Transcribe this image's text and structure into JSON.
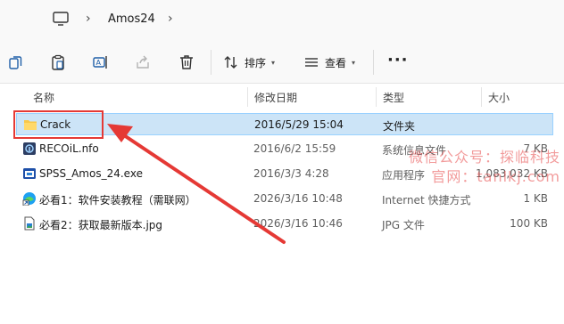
{
  "address": {
    "path": "Amos24"
  },
  "toolbar": {
    "sort_label": "排序",
    "view_label": "查看"
  },
  "columns": {
    "name": "名称",
    "modified": "修改日期",
    "type": "类型",
    "size": "大小"
  },
  "files": [
    {
      "name": "Crack",
      "modified": "2016/5/29 15:04",
      "type": "文件夹",
      "size": "",
      "icon": "folder-icon",
      "selected": true
    },
    {
      "name": "RECOiL.nfo",
      "modified": "2016/6/2 15:59",
      "type": "系统信息文件",
      "size": "7 KB",
      "icon": "system-info-file-icon"
    },
    {
      "name": "SPSS_Amos_24.exe",
      "modified": "2016/3/3 4:28",
      "type": "应用程序",
      "size": "1,083,032 KB",
      "icon": "application-icon"
    },
    {
      "name": "必看1：软件安装教程（需联网）",
      "modified": "2026/3/16 10:48",
      "type": "Internet 快捷方式",
      "size": "1 KB",
      "icon": "internet-shortcut-icon"
    },
    {
      "name": "必看2：获取最新版本.jpg",
      "modified": "2026/3/16 10:46",
      "type": "JPG 文件",
      "size": "100 KB",
      "icon": "jpg-file-icon"
    }
  ],
  "watermark": {
    "line1": "微信公众号：探临科技",
    "line2": "官网：tanlkj.com"
  },
  "colors": {
    "selection": "#cce4f7",
    "annotation": "#e53935",
    "folder": "#f8c84a"
  }
}
